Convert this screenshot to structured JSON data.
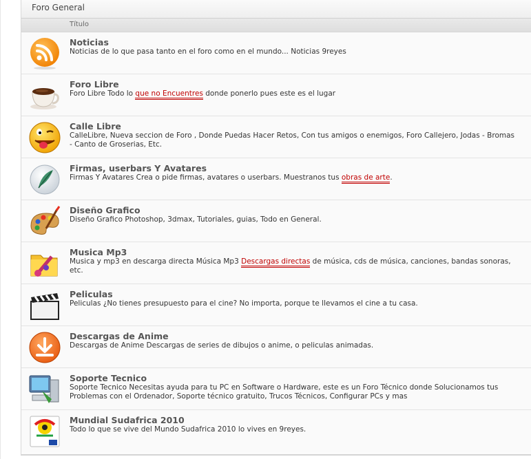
{
  "header": {
    "title": "Foro General"
  },
  "columns": {
    "title": "Título"
  },
  "forums": [
    {
      "icon": "rss-icon",
      "title": "Noticias",
      "desc_pre": "Noticias de lo que pasa tanto en el foro como en el mundo... Noticias 9reyes",
      "link": "",
      "desc_post": ""
    },
    {
      "icon": "coffee-cup-icon",
      "title": "Foro Libre",
      "desc_pre": "Foro Libre Todo lo ",
      "link": "que no Encuentres",
      "desc_post": " donde ponerlo pues este es el lugar"
    },
    {
      "icon": "smiley-tongue-icon",
      "title": "Calle Libre",
      "desc_pre": "CalleLibre, Nueva seccion de Foro , Donde Puedas Hacer Retos, Con tus amigos o enemigos, Foro Callejero, Jodas - Bromas - Canto de Groserias, Etc.",
      "link": "",
      "desc_post": ""
    },
    {
      "icon": "quill-pen-icon",
      "title": "Firmas, userbars Y Avatares",
      "desc_pre": "Firmas Y Avatares Crea o pide firmas, avatares o userbars. Muestranos tus ",
      "link": "obras de arte",
      "desc_post": "."
    },
    {
      "icon": "paint-palette-icon",
      "title": "Diseño Grafico",
      "desc_pre": "Diseño Grafico Photoshop, 3dmax, Tutoriales, guias, Todo en General.",
      "link": "",
      "desc_post": ""
    },
    {
      "icon": "music-folder-icon",
      "title": "Musica Mp3",
      "desc_pre": "Musica y mp3 en descarga directa Música Mp3 ",
      "link": "Descargas directas",
      "desc_post": " de música, cds de música, canciones, bandas sonoras, etc."
    },
    {
      "icon": "clapperboard-icon",
      "title": "Peliculas",
      "desc_pre": "Peliculas ¿No tienes presupuesto para el cine? No importa, porque te llevamos el cine a tu casa.",
      "link": "",
      "desc_post": ""
    },
    {
      "icon": "download-arrow-icon",
      "title": "Descargas de Anime",
      "desc_pre": "Descargas de Anime Descargas de series de dibujos o anime, o peliculas animadas.",
      "link": "",
      "desc_post": ""
    },
    {
      "icon": "computer-support-icon",
      "title": "Soporte Tecnico",
      "desc_pre": "Soporte Tecnico Necesitas ayuda para tu PC en Software o Hardware, este es un Foro Técnico donde Solucionamos tus Problemas con el Ordenador, Soporte técnico gratuito, Trucos Técnicos, Configurar PCs y mas",
      "link": "",
      "desc_post": ""
    },
    {
      "icon": "world-cup-logo-icon",
      "title": "Mundial Sudafrica 2010",
      "desc_pre": "Todo lo que se vive del Mundo Sudafrica 2010 lo vives en 9reyes.",
      "link": "",
      "desc_post": ""
    }
  ]
}
